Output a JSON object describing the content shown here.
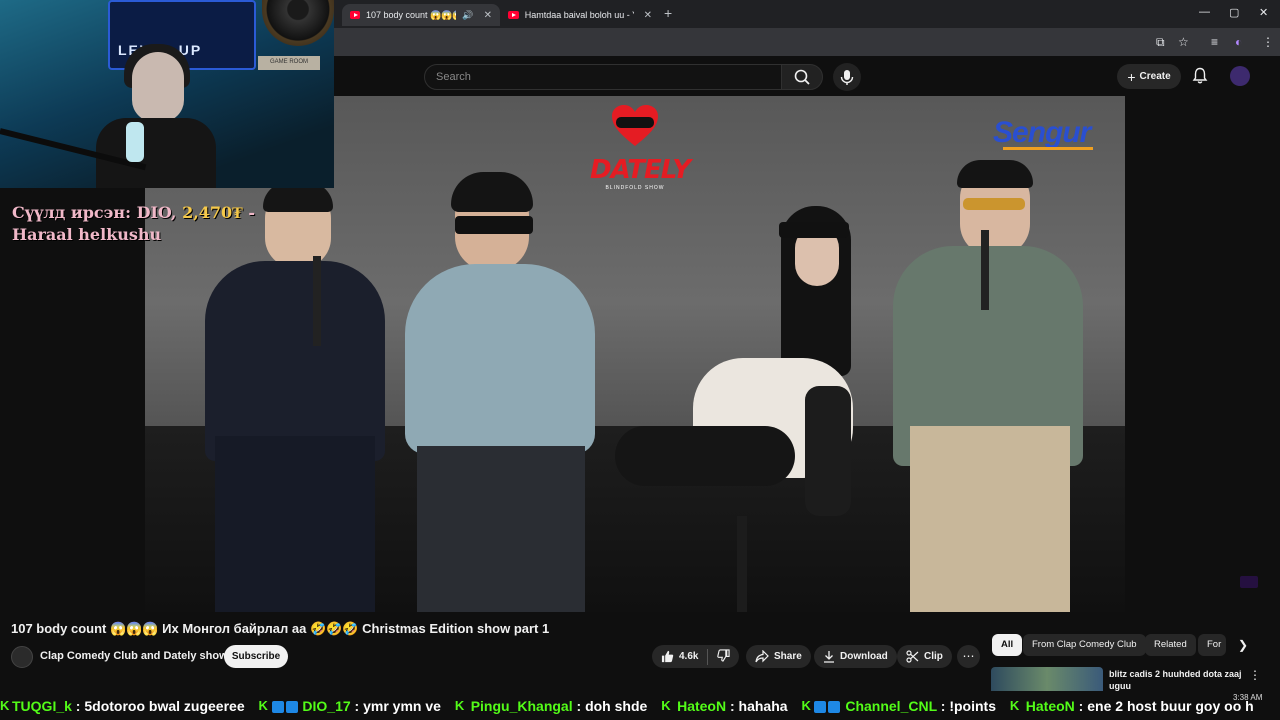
{
  "browser": {
    "tabs": [
      {
        "title": "107 body count 😱😱😱 Их"
      },
      {
        "title": "Hamtdaa baival boloh uu - You"
      }
    ],
    "new_tab": "+",
    "window_controls": {
      "minimize": "—",
      "restore": "▢",
      "close": "✕"
    }
  },
  "youtube": {
    "search_placeholder": "Search",
    "create_label": "Create",
    "video": {
      "title": "107 body count 😱😱😱 Их Монгол байрлал аа 🤣🤣🤣 Christmas Edition show part 1",
      "channel": "Clap Comedy Club and Dately show",
      "subscribe_label": "Subscribe",
      "likes": "4.6k",
      "share_label": "Share",
      "download_label": "Download",
      "clip_label": "Clip",
      "overlay_logo": "DATELY",
      "overlay_logo_sub": "BLINDFOLD SHOW",
      "overlay_sponsor": "Sengur"
    },
    "chips": [
      "All",
      "From Clap Comedy Club",
      "Related",
      "For"
    ],
    "recommended": [
      {
        "title": "blitz cadis 2 huuhded dota zaaj uguu"
      }
    ]
  },
  "stream_overlay": {
    "webcam_sign": "LEVEL UP",
    "game_room": "GAME ROOM",
    "donation_label": "Сүүлд ирсэн: DIO, ",
    "donation_amount": "2,470₮",
    "donation_dash": " -",
    "donation_message": "Haraal helkushu"
  },
  "chat_ticker": [
    {
      "user": "TUQGI_k",
      "message": "5dotoroo bwal zugeeree"
    },
    {
      "user": "DIO_17",
      "message": "ymr ymn ve"
    },
    {
      "user": "Pingu_Khangal",
      "message": "doh shde"
    },
    {
      "user": "HateoN",
      "message": "hahaha"
    },
    {
      "user": "Channel_CNL",
      "message": "!points"
    },
    {
      "user": "HateoN",
      "message": "ene 2 host buur goy oo h"
    }
  ],
  "clock": "3:38 AM",
  "colors": {
    "kick_green": "#53fc18",
    "yt_red": "#ff0033",
    "dately_red": "#e51c23",
    "donation_pink": "#f0b8c8",
    "donation_gold": "#f6c94a"
  }
}
